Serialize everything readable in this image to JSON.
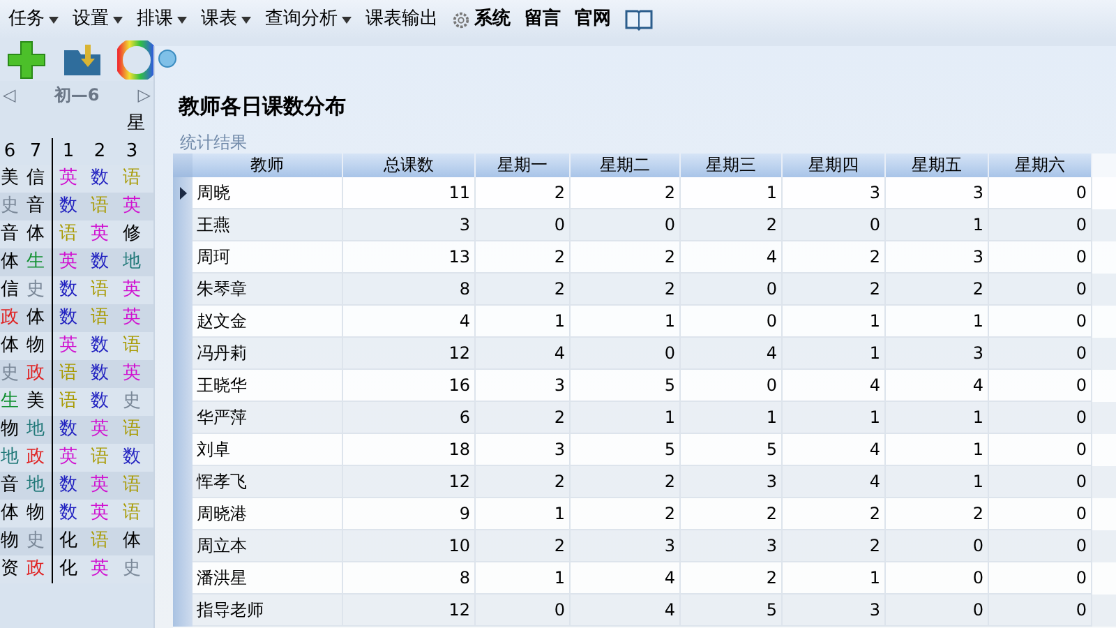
{
  "menu": [
    {
      "label": "任务",
      "kind": "dropdown"
    },
    {
      "label": "设置",
      "kind": "dropdown"
    },
    {
      "label": "排课",
      "kind": "dropdown"
    },
    {
      "label": "课表",
      "kind": "dropdown"
    },
    {
      "label": "查询分析",
      "kind": "dropdown"
    },
    {
      "label": "课表输出",
      "kind": "plain"
    },
    {
      "label": "系统",
      "kind": "settings"
    },
    {
      "label": "留言",
      "kind": "bold"
    },
    {
      "label": "官网",
      "kind": "bold"
    },
    {
      "kind": "book"
    }
  ],
  "timetable": {
    "class_name": "初—6",
    "prev": "◁",
    "next": "▷",
    "day": "星",
    "columns": [
      "6",
      "7",
      "1",
      "2",
      "3"
    ],
    "rows": [
      [
        {
          "t": "美",
          "color": "#000000"
        },
        {
          "t": "信",
          "color": "#000000"
        },
        {
          "t": "英",
          "color": "#d010d0"
        },
        {
          "t": "数",
          "color": "#2020c0"
        },
        {
          "t": "语",
          "color": "#a89a00"
        }
      ],
      [
        {
          "t": "史",
          "color": "#7a8898"
        },
        {
          "t": "音",
          "color": "#000000"
        },
        {
          "t": "数",
          "color": "#2020c0"
        },
        {
          "t": "语",
          "color": "#a89a00"
        },
        {
          "t": "英",
          "color": "#d010d0"
        }
      ],
      [
        {
          "t": "音",
          "color": "#000000"
        },
        {
          "t": "体",
          "color": "#000000"
        },
        {
          "t": "语",
          "color": "#a89a00"
        },
        {
          "t": "英",
          "color": "#d010d0"
        },
        {
          "t": "修",
          "color": "#000000"
        }
      ],
      [
        {
          "t": "体",
          "color": "#000000"
        },
        {
          "t": "生",
          "color": "#109030"
        },
        {
          "t": "英",
          "color": "#d010d0"
        },
        {
          "t": "数",
          "color": "#2020c0"
        },
        {
          "t": "地",
          "color": "#207878"
        }
      ],
      [
        {
          "t": "信",
          "color": "#000000"
        },
        {
          "t": "史",
          "color": "#7a8898"
        },
        {
          "t": "数",
          "color": "#2020c0"
        },
        {
          "t": "语",
          "color": "#a89a00"
        },
        {
          "t": "英",
          "color": "#d010d0"
        }
      ],
      [
        {
          "t": "政",
          "color": "#e02020"
        },
        {
          "t": "体",
          "color": "#000000"
        },
        {
          "t": "数",
          "color": "#2020c0"
        },
        {
          "t": "语",
          "color": "#a89a00"
        },
        {
          "t": "英",
          "color": "#d010d0"
        }
      ],
      [
        {
          "t": "体",
          "color": "#000000"
        },
        {
          "t": "物",
          "color": "#000000"
        },
        {
          "t": "英",
          "color": "#d010d0"
        },
        {
          "t": "数",
          "color": "#2020c0"
        },
        {
          "t": "语",
          "color": "#a89a00"
        }
      ],
      [
        {
          "t": "史",
          "color": "#7a8898"
        },
        {
          "t": "政",
          "color": "#e02020"
        },
        {
          "t": "语",
          "color": "#a89a00"
        },
        {
          "t": "数",
          "color": "#2020c0"
        },
        {
          "t": "英",
          "color": "#d010d0"
        }
      ],
      [
        {
          "t": "生",
          "color": "#109030"
        },
        {
          "t": "美",
          "color": "#000000"
        },
        {
          "t": "语",
          "color": "#a89a00"
        },
        {
          "t": "数",
          "color": "#2020c0"
        },
        {
          "t": "史",
          "color": "#7a8898"
        }
      ],
      [
        {
          "t": "物",
          "color": "#000000"
        },
        {
          "t": "地",
          "color": "#207878"
        },
        {
          "t": "数",
          "color": "#2020c0"
        },
        {
          "t": "英",
          "color": "#d010d0"
        },
        {
          "t": "语",
          "color": "#a89a00"
        }
      ],
      [
        {
          "t": "地",
          "color": "#207878"
        },
        {
          "t": "政",
          "color": "#e02020"
        },
        {
          "t": "英",
          "color": "#d010d0"
        },
        {
          "t": "语",
          "color": "#a89a00"
        },
        {
          "t": "数",
          "color": "#2020c0"
        }
      ],
      [
        {
          "t": "音",
          "color": "#000000"
        },
        {
          "t": "地",
          "color": "#207878"
        },
        {
          "t": "数",
          "color": "#2020c0"
        },
        {
          "t": "英",
          "color": "#d010d0"
        },
        {
          "t": "语",
          "color": "#a89a00"
        }
      ],
      [
        {
          "t": "体",
          "color": "#000000"
        },
        {
          "t": "物",
          "color": "#000000"
        },
        {
          "t": "数",
          "color": "#2020c0"
        },
        {
          "t": "英",
          "color": "#d010d0"
        },
        {
          "t": "语",
          "color": "#a89a00"
        }
      ],
      [
        {
          "t": "物",
          "color": "#000000"
        },
        {
          "t": "史",
          "color": "#7a8898"
        },
        {
          "t": "化",
          "color": "#000000"
        },
        {
          "t": "语",
          "color": "#a89a00"
        },
        {
          "t": "体",
          "color": "#000000"
        }
      ],
      [
        {
          "t": "资",
          "color": "#000000"
        },
        {
          "t": "政",
          "color": "#e02020"
        },
        {
          "t": "化",
          "color": "#000000"
        },
        {
          "t": "英",
          "color": "#d010d0"
        },
        {
          "t": "史",
          "color": "#7a8898"
        }
      ]
    ]
  },
  "dialog": {
    "title": "教师各日课数分布",
    "group_label": "统计结果",
    "table": {
      "columns": [
        "教师",
        "总课数",
        "星期一",
        "星期二",
        "星期三",
        "星期四",
        "星期五",
        "星期六"
      ],
      "rows": [
        {
          "selected": true,
          "cells": [
            "周晓",
            "11",
            "2",
            "2",
            "1",
            "3",
            "3",
            "0"
          ]
        },
        {
          "selected": false,
          "cells": [
            "王燕",
            "3",
            "0",
            "0",
            "2",
            "0",
            "1",
            "0"
          ]
        },
        {
          "selected": false,
          "cells": [
            "周珂",
            "13",
            "2",
            "2",
            "4",
            "2",
            "3",
            "0"
          ]
        },
        {
          "selected": false,
          "cells": [
            "朱琴章",
            "8",
            "2",
            "2",
            "0",
            "2",
            "2",
            "0"
          ]
        },
        {
          "selected": false,
          "cells": [
            "赵文金",
            "4",
            "1",
            "1",
            "0",
            "1",
            "1",
            "0"
          ]
        },
        {
          "selected": false,
          "cells": [
            "冯丹莉",
            "12",
            "4",
            "0",
            "4",
            "1",
            "3",
            "0"
          ]
        },
        {
          "selected": false,
          "cells": [
            "王晓华",
            "16",
            "3",
            "5",
            "0",
            "4",
            "4",
            "0"
          ]
        },
        {
          "selected": false,
          "cells": [
            "华严萍",
            "6",
            "2",
            "1",
            "1",
            "1",
            "1",
            "0"
          ]
        },
        {
          "selected": false,
          "cells": [
            "刘卓",
            "18",
            "3",
            "5",
            "5",
            "4",
            "1",
            "0"
          ]
        },
        {
          "selected": false,
          "cells": [
            "恽孝飞",
            "12",
            "2",
            "2",
            "3",
            "4",
            "1",
            "0"
          ]
        },
        {
          "selected": false,
          "cells": [
            "周晓港",
            "9",
            "1",
            "2",
            "2",
            "2",
            "2",
            "0"
          ]
        },
        {
          "selected": false,
          "cells": [
            "周立本",
            "10",
            "2",
            "3",
            "3",
            "2",
            "0",
            "0"
          ]
        },
        {
          "selected": false,
          "cells": [
            "潘洪星",
            "8",
            "1",
            "4",
            "2",
            "1",
            "0",
            "0"
          ]
        },
        {
          "selected": false,
          "cells": [
            "指导老师",
            "12",
            "0",
            "4",
            "5",
            "3",
            "0",
            "0"
          ]
        }
      ]
    }
  }
}
